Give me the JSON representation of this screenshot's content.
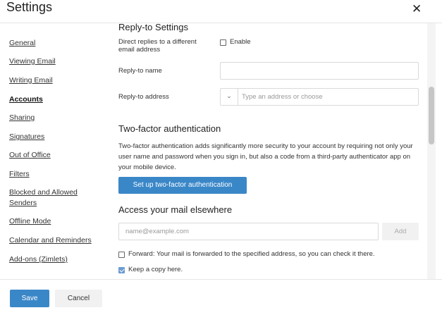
{
  "header": {
    "title": "Settings",
    "close_glyph": "✕"
  },
  "sidebar": {
    "items": [
      {
        "label": "General",
        "active": false
      },
      {
        "label": "Viewing Email",
        "active": false
      },
      {
        "label": "Writing Email",
        "active": false
      },
      {
        "label": "Accounts",
        "active": true
      },
      {
        "label": "Sharing",
        "active": false
      },
      {
        "label": "Signatures",
        "active": false
      },
      {
        "label": "Out of Office",
        "active": false
      },
      {
        "label": "Filters",
        "active": false
      },
      {
        "label": "Blocked and Allowed Senders",
        "active": false
      },
      {
        "label": "Offline Mode",
        "active": false
      },
      {
        "label": "Calendar and Reminders",
        "active": false
      },
      {
        "label": "Add-ons (Zimlets)",
        "active": false
      }
    ]
  },
  "reply_to": {
    "heading": "Reply-to Settings",
    "direct_label": "Direct replies to a different email address",
    "enable_label": "Enable",
    "enable_checked": false,
    "name_label": "Reply-to name",
    "name_value": "",
    "address_label": "Reply-to address",
    "address_placeholder": "Type an address or choose",
    "combo_glyph": "⌄"
  },
  "two_factor": {
    "heading": "Two-factor authentication",
    "description": "Two-factor authentication adds significantly more security to your account by requiring not only your user name and password when you sign in, but also a code from a third-party authenticator app on your mobile device.",
    "setup_button": "Set up two-factor authentication"
  },
  "access": {
    "heading": "Access your mail elsewhere",
    "email_placeholder": "name@example.com",
    "add_button": "Add",
    "forward_label": "Forward: Your mail is forwarded to the specified address, so you can check it there.",
    "forward_checked": false,
    "keep_copy_label": "Keep a copy here.",
    "keep_copy_checked": true
  },
  "footer": {
    "save_label": "Save",
    "cancel_label": "Cancel"
  },
  "colors": {
    "accent": "#3a87c8",
    "checkbox_checked": "#6b9bd1"
  }
}
